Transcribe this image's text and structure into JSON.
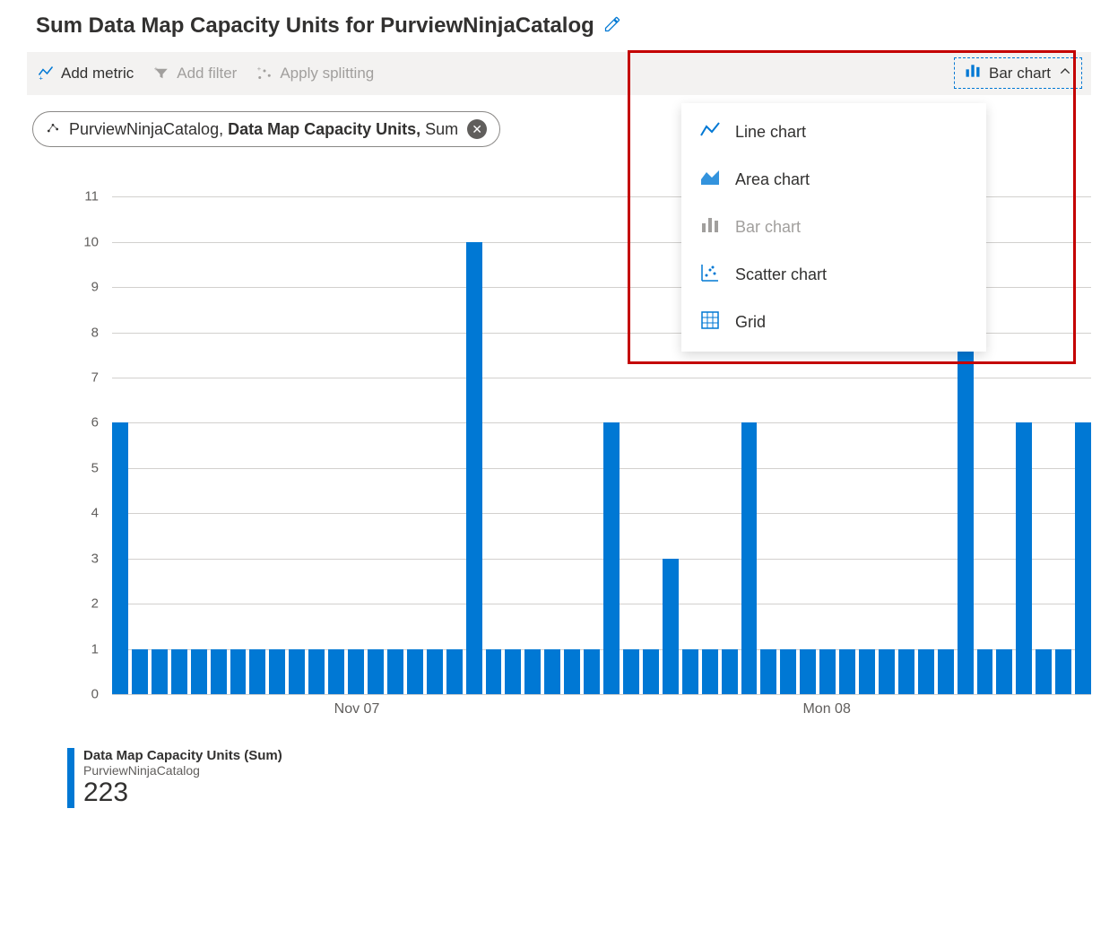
{
  "title": "Sum Data Map Capacity Units for PurviewNinjaCatalog",
  "toolbar": {
    "add_metric": "Add metric",
    "add_filter": "Add filter",
    "apply_splitting": "Apply splitting",
    "chart_type_selected": "Bar chart"
  },
  "chart_type_menu": {
    "line": "Line chart",
    "area": "Area chart",
    "bar": "Bar chart",
    "scatter": "Scatter chart",
    "grid": "Grid"
  },
  "metric_chip": {
    "resource": "PurviewNinjaCatalog, ",
    "metric": "Data Map Capacity Units, ",
    "aggregation": "Sum"
  },
  "legend": {
    "title": "Data Map Capacity Units (Sum)",
    "subtitle": "PurviewNinjaCatalog",
    "value": "223"
  },
  "chart_data": {
    "type": "bar",
    "title": "Sum Data Map Capacity Units for PurviewNinjaCatalog",
    "ylabel": "",
    "xlabel": "",
    "ylim": [
      0,
      11.5
    ],
    "y_ticks": [
      0,
      1,
      2,
      3,
      4,
      5,
      6,
      7,
      8,
      9,
      10,
      11
    ],
    "x_ticks": [
      {
        "pos_pct": 25,
        "label": "Nov 07"
      },
      {
        "pos_pct": 73,
        "label": "Mon 08"
      }
    ],
    "values": [
      6,
      1,
      1,
      1,
      1,
      1,
      1,
      1,
      1,
      1,
      1,
      1,
      1,
      1,
      1,
      1,
      1,
      1,
      10,
      1,
      1,
      1,
      1,
      1,
      1,
      6,
      1,
      1,
      3,
      1,
      1,
      1,
      6,
      1,
      1,
      1,
      1,
      1,
      1,
      1,
      1,
      1,
      1,
      9,
      1,
      1,
      6,
      1,
      1,
      6
    ],
    "bar_color": "#0078d4"
  }
}
